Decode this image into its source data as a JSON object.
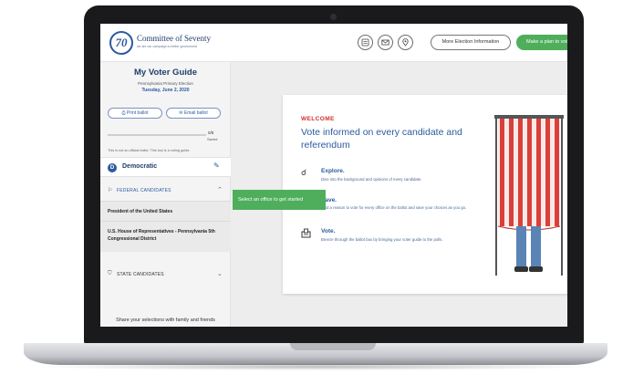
{
  "header": {
    "logo_mark": "70",
    "logo_name": "Committee of Seventy",
    "logo_tagline": "we are our campaign to better government",
    "icons": [
      "ballot-icon",
      "mail-icon",
      "location-pin-icon"
    ],
    "more_info_label": "More Election Information",
    "plan_label": "Make a plan to vote"
  },
  "sidebar": {
    "title": "My Voter Guide",
    "election": "Pennsylvania Primary Election",
    "date": "Tuesday, June 2, 2020",
    "print_label": "Print ballot",
    "email_label": "Email ballot",
    "progress_count": "0/5",
    "progress_fraction": 0,
    "progress_saved": "Saved",
    "disclaimer": "This is not an official ballot. This tool is a voting guide.",
    "party": "Democratic",
    "party_initial": "D",
    "federal_label": "FEDERAL CANDIDATES",
    "offices": [
      "President of the United States",
      "U.S. House of Representatives - Pennsylvania 5th Congressional District"
    ],
    "state_label": "STATE CANDIDATES",
    "share_text": "Share your selections with family and friends"
  },
  "tooltip": "Select an office to get started",
  "main": {
    "welcome": "WELCOME",
    "headline": "Vote informed on every candidate and referendum",
    "steps": [
      {
        "title": "Explore.",
        "desc": "Dive into the background and opinions of every candidate.",
        "icon": "explore-icon"
      },
      {
        "title": "Save.",
        "desc": "Find a reason to vote for every office on the ballot and save your choices as you go.",
        "icon": "save-icon"
      },
      {
        "title": "Vote.",
        "desc": "Breeze through the ballot box by bringing your voter guide to the polls.",
        "icon": "ballot-box-icon"
      }
    ]
  },
  "colors": {
    "brand_blue": "#2c5aa0",
    "accent_green": "#4fae5b",
    "welcome_red": "#d0312d"
  }
}
